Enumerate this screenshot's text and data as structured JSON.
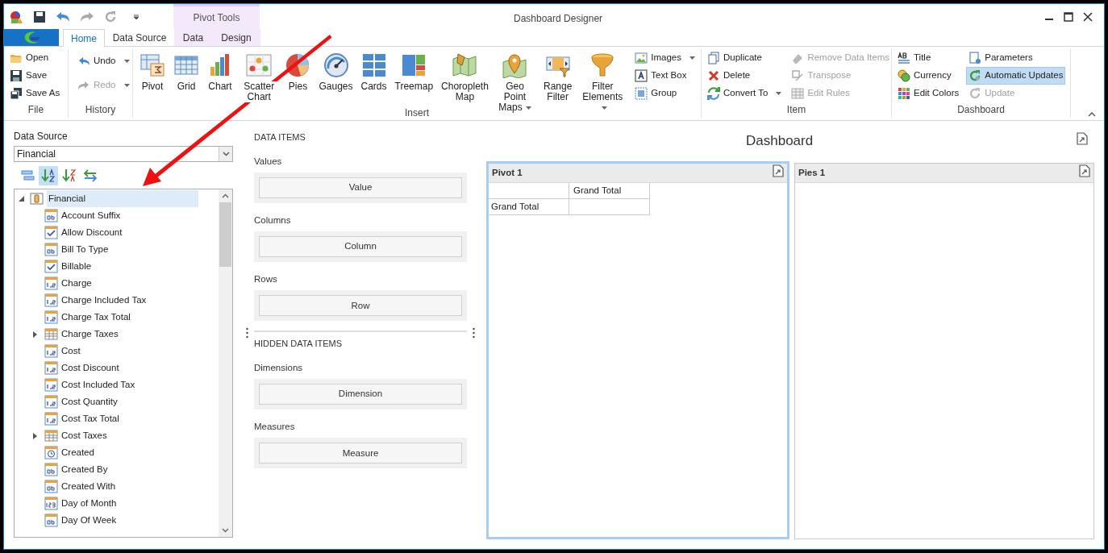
{
  "window": {
    "title": "Dashboard Designer"
  },
  "contextual_group": {
    "label": "Pivot Tools"
  },
  "tabs": [
    {
      "label": "Home",
      "selected": true,
      "kind": "normal"
    },
    {
      "label": "Data Source",
      "selected": false,
      "kind": "normal"
    },
    {
      "label": "Data",
      "selected": false,
      "kind": "contextual"
    },
    {
      "label": "Design",
      "selected": false,
      "kind": "contextual"
    }
  ],
  "ribbon": {
    "groups": [
      {
        "label": "File",
        "items": [
          {
            "label": "Open",
            "kind": "small",
            "disabled": false,
            "checked": false
          },
          {
            "label": "Save",
            "kind": "small",
            "disabled": false,
            "checked": false
          },
          {
            "label": "Save As",
            "kind": "small",
            "disabled": false,
            "checked": false
          }
        ]
      },
      {
        "label": "History",
        "items": [
          {
            "label": "Undo",
            "kind": "small",
            "dropdown": true,
            "disabled": false,
            "checked": false
          },
          {
            "label": "Redo",
            "kind": "small",
            "dropdown": true,
            "disabled": true,
            "checked": false
          }
        ]
      },
      {
        "label": "Insert",
        "items": [
          {
            "label": "Pivot",
            "kind": "large",
            "disabled": false,
            "checked": false
          },
          {
            "label": "Grid",
            "kind": "large",
            "disabled": false,
            "checked": false
          },
          {
            "label": "Chart",
            "kind": "large",
            "disabled": false,
            "checked": false
          },
          {
            "label": "Scatter Chart",
            "kind": "large",
            "disabled": false,
            "checked": false
          },
          {
            "label": "Pies",
            "kind": "large",
            "disabled": false,
            "checked": false
          },
          {
            "label": "Gauges",
            "kind": "large",
            "disabled": false,
            "checked": false
          },
          {
            "label": "Cards",
            "kind": "large",
            "disabled": false,
            "checked": false
          },
          {
            "label": "Treemap",
            "kind": "large",
            "disabled": false,
            "checked": false
          },
          {
            "label": "Choropleth Map",
            "kind": "large",
            "disabled": false,
            "checked": false
          },
          {
            "label": "Geo Point Maps",
            "kind": "large",
            "dropdown": true,
            "disabled": false,
            "checked": false
          },
          {
            "label": "Range Filter",
            "kind": "large",
            "disabled": false,
            "checked": false
          },
          {
            "label": "Filter Elements",
            "kind": "large",
            "dropdown": true,
            "disabled": false,
            "checked": false
          },
          {
            "label": "Images",
            "kind": "small",
            "dropdown": true,
            "disabled": false,
            "checked": false
          },
          {
            "label": "Text Box",
            "kind": "small",
            "disabled": false,
            "checked": false
          },
          {
            "label": "Group",
            "kind": "small",
            "disabled": false,
            "checked": false
          }
        ]
      },
      {
        "label": "Item",
        "items": [
          {
            "label": "Duplicate",
            "kind": "small",
            "disabled": false,
            "checked": false
          },
          {
            "label": "Delete",
            "kind": "small",
            "disabled": false,
            "checked": false
          },
          {
            "label": "Convert To",
            "kind": "small",
            "dropdown": true,
            "disabled": false,
            "checked": false
          },
          {
            "label": "Remove Data Items",
            "kind": "small",
            "disabled": true,
            "checked": false
          },
          {
            "label": "Transpose",
            "kind": "small",
            "disabled": true,
            "checked": false
          },
          {
            "label": "Edit Rules",
            "kind": "small",
            "disabled": true,
            "checked": false
          }
        ]
      },
      {
        "label": "Dashboard",
        "items": [
          {
            "label": "Title",
            "kind": "small",
            "disabled": false,
            "checked": false
          },
          {
            "label": "Currency",
            "kind": "small",
            "disabled": false,
            "checked": false
          },
          {
            "label": "Edit Colors",
            "kind": "small",
            "disabled": false,
            "checked": false
          },
          {
            "label": "Parameters",
            "kind": "small",
            "disabled": false,
            "checked": false
          },
          {
            "label": "Automatic Updates",
            "kind": "small",
            "disabled": false,
            "checked": true
          },
          {
            "label": "Update",
            "kind": "small",
            "disabled": true,
            "checked": false
          }
        ]
      }
    ]
  },
  "left_panel": {
    "data_source": {
      "label": "Data Source",
      "value": "Financial"
    },
    "toolbar": [
      {
        "selected": false
      },
      {
        "selected": true
      },
      {
        "selected": false
      },
      {
        "selected": false
      }
    ],
    "tree": [
      {
        "label": "Financial",
        "kind": "datasource",
        "expanded": true,
        "selected": true,
        "children": [
          {
            "label": "Account Suffix",
            "kind": "text",
            "selected": false
          },
          {
            "label": "Allow Discount",
            "kind": "boolean",
            "selected": false
          },
          {
            "label": "Bill To Type",
            "kind": "text",
            "selected": false
          },
          {
            "label": "Billable",
            "kind": "boolean",
            "selected": false
          },
          {
            "label": "Charge",
            "kind": "number",
            "selected": false
          },
          {
            "label": "Charge Included Tax",
            "kind": "number",
            "selected": false
          },
          {
            "label": "Charge Tax Total",
            "kind": "number",
            "selected": false
          },
          {
            "label": "Charge Taxes",
            "kind": "table",
            "expanded": false,
            "selected": false
          },
          {
            "label": "Cost",
            "kind": "number",
            "selected": false
          },
          {
            "label": "Cost Discount",
            "kind": "number",
            "selected": false
          },
          {
            "label": "Cost Included Tax",
            "kind": "number",
            "selected": false
          },
          {
            "label": "Cost Quantity",
            "kind": "number",
            "selected": false
          },
          {
            "label": "Cost Tax Total",
            "kind": "number",
            "selected": false
          },
          {
            "label": "Cost Taxes",
            "kind": "table",
            "expanded": false,
            "selected": false
          },
          {
            "label": "Created",
            "kind": "datetime",
            "selected": false
          },
          {
            "label": "Created By",
            "kind": "text",
            "selected": false
          },
          {
            "label": "Created With",
            "kind": "text",
            "selected": false
          },
          {
            "label": "Day of Month",
            "kind": "integer",
            "selected": false
          },
          {
            "label": "Day Of Week",
            "kind": "text",
            "selected": false
          }
        ]
      }
    ]
  },
  "data_items": {
    "heading": "DATA ITEMS",
    "sections": [
      {
        "label": "Values",
        "drop_label": "Value"
      },
      {
        "label": "Columns",
        "drop_label": "Column"
      },
      {
        "label": "Rows",
        "drop_label": "Row"
      }
    ]
  },
  "hidden_data_items": {
    "heading": "HIDDEN DATA ITEMS",
    "sections": [
      {
        "label": "Dimensions",
        "drop_label": "Dimension"
      },
      {
        "label": "Measures",
        "drop_label": "Measure"
      }
    ]
  },
  "dashboard": {
    "title": "Dashboard",
    "items": [
      {
        "title": "Pivot 1",
        "kind": "pivot",
        "selected": true,
        "grid": {
          "column_header": "Grand Total",
          "row_header": "Grand Total"
        }
      },
      {
        "title": "Pies 1",
        "kind": "pies",
        "selected": false
      }
    ]
  }
}
